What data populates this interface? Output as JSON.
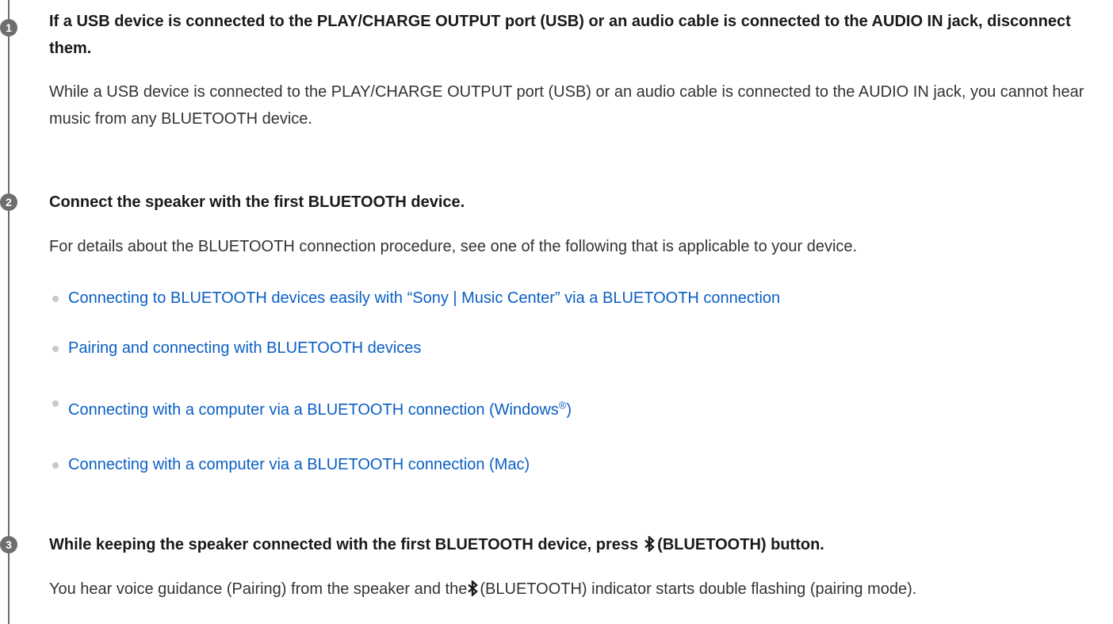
{
  "steps": [
    {
      "number": "1",
      "heading": "If a USB device is connected to the PLAY/CHARGE OUTPUT port (USB) or an audio cable is connected to the AUDIO IN jack, disconnect them.",
      "body": "While a USB device is connected to the PLAY/CHARGE OUTPUT port (USB) or an audio cable is connected to the AUDIO IN jack, you cannot hear music from any BLUETOOTH device."
    },
    {
      "number": "2",
      "heading": "Connect the speaker with the first BLUETOOTH device.",
      "body": "For details about the BLUETOOTH connection procedure, see one of the following that is applicable to your device.",
      "links": [
        "Connecting to BLUETOOTH devices easily with “Sony | Music Center” via a BLUETOOTH connection",
        "Pairing and connecting with BLUETOOTH devices",
        "Connecting with a computer via a BLUETOOTH connection (Windows",
        "Connecting with a computer via a BLUETOOTH connection (Mac)"
      ],
      "windows_registered_mark": "®",
      "windows_close_paren": ")"
    },
    {
      "number": "3",
      "heading_before_icon": "While keeping the speaker connected with the first BLUETOOTH device, press",
      "heading_after_icon": "(BLUETOOTH) button.",
      "body_before_icon": "You hear voice guidance (Pairing) from the speaker and the",
      "body_after_icon": "(BLUETOOTH) indicator starts double flashing (pairing mode)."
    }
  ],
  "icons": {
    "bluetooth": "bluetooth-icon",
    "bullet": "bullet-icon"
  }
}
